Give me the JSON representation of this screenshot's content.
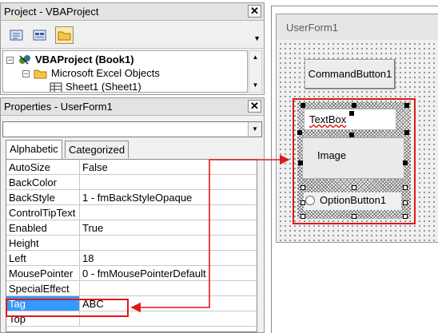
{
  "project_pane": {
    "title": "Project - VBAProject",
    "close_glyph": "✕",
    "tree": {
      "project": "VBAProject (Book1)",
      "folder": "Microsoft Excel Objects",
      "sheet": "Sheet1 (Sheet1)"
    }
  },
  "properties_pane": {
    "title": "Properties - UserForm1",
    "close_glyph": "✕",
    "object_combo_value": "",
    "tabs": {
      "alphabetic": "Alphabetic",
      "categorized": "Categorized"
    },
    "rows": [
      {
        "name": "AutoSize",
        "value": "False"
      },
      {
        "name": "BackColor",
        "value": ""
      },
      {
        "name": "BackStyle",
        "value": "1 - fmBackStyleOpaque"
      },
      {
        "name": "ControlTipText",
        "value": ""
      },
      {
        "name": "Enabled",
        "value": "True"
      },
      {
        "name": "Height",
        "value": ""
      },
      {
        "name": "Left",
        "value": "18"
      },
      {
        "name": "MousePointer",
        "value": "0 - fmMousePointerDefault"
      },
      {
        "name": "SpecialEffect",
        "value": ""
      },
      {
        "name": "Tag",
        "value": "ABC"
      },
      {
        "name": "Top",
        "value": ""
      }
    ],
    "selected_row": "Tag"
  },
  "designer": {
    "form_title": "UserForm1",
    "controls": {
      "command_button": "CommandButton1",
      "textbox": "TextBox",
      "image": "Image",
      "option_button": "OptionButton1"
    }
  },
  "colors": {
    "selection_blue": "#3399ff",
    "annotation_red": "#e01818",
    "active_toolbar_button": "#ffe8a6"
  }
}
